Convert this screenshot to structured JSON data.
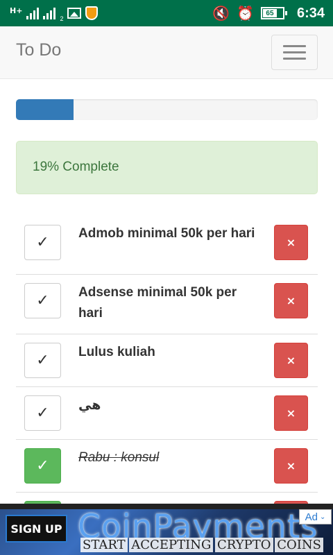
{
  "status_bar": {
    "network": "H+",
    "signal_sub": "2",
    "battery": "65",
    "time": "6:34"
  },
  "navbar": {
    "brand": "To Do",
    "menu_icon": "hamburger-icon"
  },
  "progress": {
    "percent": 19,
    "label": "19% Complete",
    "bar_color": "#337ab7"
  },
  "todos": [
    {
      "text": "Admob minimal 50k per hari",
      "done": false
    },
    {
      "text": "Adsense minimal 50k per hari",
      "done": false
    },
    {
      "text": "Lulus kuliah",
      "done": false
    },
    {
      "text": "هي",
      "done": false
    },
    {
      "text": "Rabu : konsul",
      "done": true
    }
  ],
  "check_glyph": "✓",
  "delete_glyph": "×",
  "colors": {
    "success": "#5cb85c",
    "danger": "#d9534f",
    "alert_bg": "#dff0d8",
    "alert_text": "#3c763d",
    "status_bar": "#00704a"
  },
  "ad": {
    "button": "SIGN UP",
    "brand": "CoinPayments",
    "tagline": [
      "START",
      "ACCEPTING",
      "CRYPTO",
      "COINS"
    ],
    "badge": "Ad"
  }
}
